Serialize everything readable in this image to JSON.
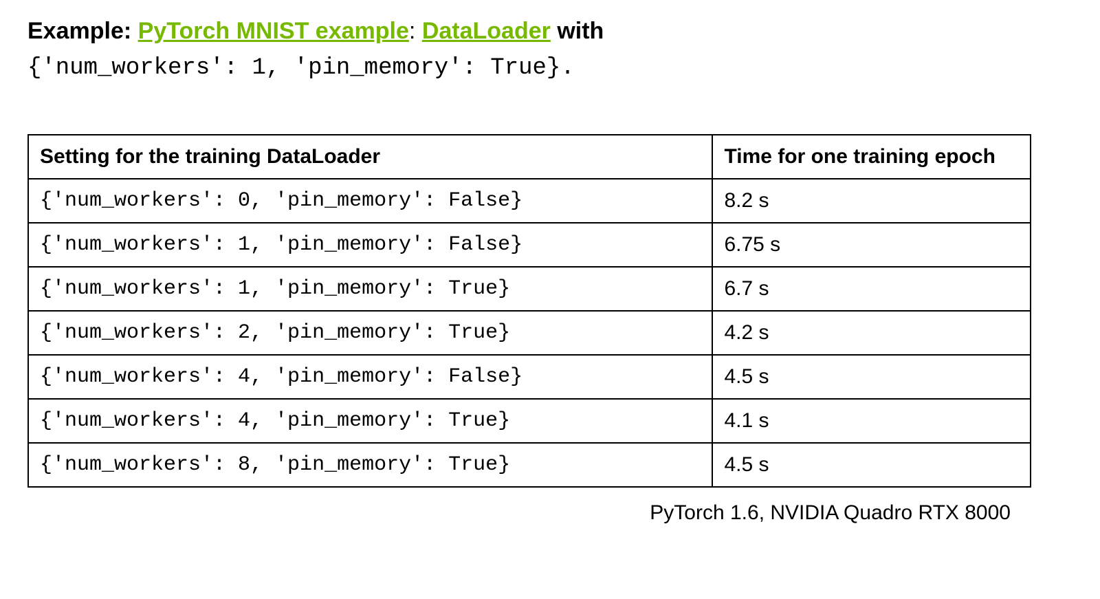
{
  "header": {
    "bold_prefix": "Example:",
    "link1": "PyTorch MNIST example",
    "separator": ":",
    "link2": "DataLoader",
    "after_links": " with",
    "code_line": "{'num_workers': 1, 'pin_memory': True}.",
    "space": " "
  },
  "table": {
    "headers": {
      "setting": "Setting for the training DataLoader",
      "time": "Time for one training epoch"
    },
    "rows": [
      {
        "setting": "{'num_workers': 0, 'pin_memory': False}",
        "time": "8.2 s"
      },
      {
        "setting": "{'num_workers': 1, 'pin_memory': False}",
        "time": "6.75 s"
      },
      {
        "setting": "{'num_workers': 1, 'pin_memory': True}",
        "time": "6.7 s"
      },
      {
        "setting": "{'num_workers': 2, 'pin_memory': True}",
        "time": "4.2 s"
      },
      {
        "setting": "{'num_workers': 4, 'pin_memory': False}",
        "time": "4.5 s"
      },
      {
        "setting": "{'num_workers': 4, 'pin_memory': True}",
        "time": "4.1 s"
      },
      {
        "setting": "{'num_workers': 8, 'pin_memory': True}",
        "time": "4.5 s"
      }
    ]
  },
  "footer": "PyTorch 1.6, NVIDIA Quadro RTX 8000",
  "chart_data": {
    "type": "table",
    "title": "DataLoader settings vs training epoch time",
    "columns": [
      "Setting for the training DataLoader",
      "Time for one training epoch"
    ],
    "data": [
      [
        "{'num_workers': 0, 'pin_memory': False}",
        "8.2 s"
      ],
      [
        "{'num_workers': 1, 'pin_memory': False}",
        "6.75 s"
      ],
      [
        "{'num_workers': 1, 'pin_memory': True}",
        "6.7 s"
      ],
      [
        "{'num_workers': 2, 'pin_memory': True}",
        "4.2 s"
      ],
      [
        "{'num_workers': 4, 'pin_memory': False}",
        "4.5 s"
      ],
      [
        "{'num_workers': 4, 'pin_memory': True}",
        "4.1 s"
      ],
      [
        "{'num_workers': 8, 'pin_memory': True}",
        "4.5 s"
      ]
    ]
  }
}
